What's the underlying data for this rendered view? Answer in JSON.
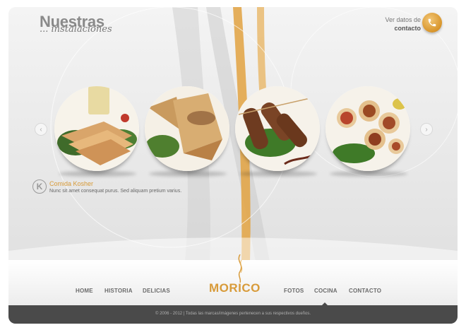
{
  "header": {
    "title_main": "Nuestras",
    "title_sub": "... instalaciones",
    "contact_line1": "Ver datos de",
    "contact_line2": "contacto"
  },
  "carousel": {
    "prev_icon": "chevron-left-icon",
    "next_icon": "chevron-right-icon",
    "dishes": [
      "quesadillas",
      "samosas",
      "kebabs",
      "wraps"
    ]
  },
  "caption": {
    "logo_letter": "K",
    "title": "Comida Kosher",
    "description": "Nunc sit amet consequat purus. Sed aliquam pretium varius."
  },
  "nav": {
    "home": "HOME",
    "historia": "HISTORIA",
    "delicias": "DELICIAS",
    "logo": "MORICO",
    "fotos": "FOTOS",
    "cocina": "COCINA",
    "contacto": "CONTACTO"
  },
  "footer": {
    "text": "© 2006 - 2012 | Todas las marcas/imágenes pertenecen a sus respectivos dueños."
  },
  "colors": {
    "accent": "#d89b3a",
    "nav_text": "#6b6b6b",
    "footer_bg": "#4a4a4a"
  }
}
